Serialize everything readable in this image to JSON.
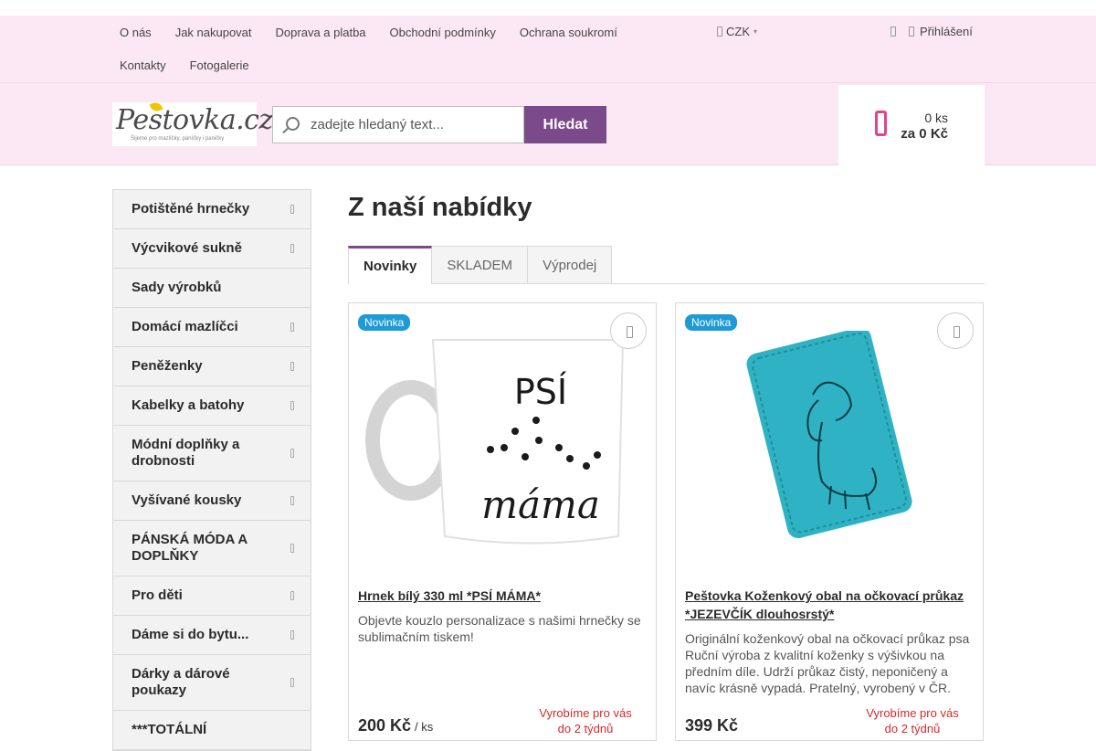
{
  "top_nav": {
    "row1": [
      "O nás",
      "Jak nakupovat",
      "Doprava a platba",
      "Obchodní podmínky",
      "Ochrana soukromí"
    ],
    "row2": [
      "Kontakty",
      "Fotogalerie"
    ],
    "currency": "CZK",
    "login": "Přihlášení"
  },
  "header": {
    "logo_text": "Pestovka.cz",
    "logo_tagline": "Šijeme pro mazlíčky, páníčky i paničky",
    "search_placeholder": "zadejte hledaný text...",
    "search_button": "Hledat",
    "cart_qty": "0 ks",
    "cart_total": "za 0 Kč"
  },
  "sidebar": {
    "items": [
      {
        "label": "Potištěné hrnečky",
        "has_sub": true
      },
      {
        "label": "Výcvikové sukně",
        "has_sub": true
      },
      {
        "label": "Sady výrobků",
        "has_sub": false
      },
      {
        "label": "Domácí mazlíčci",
        "has_sub": true
      },
      {
        "label": "Peněženky",
        "has_sub": true
      },
      {
        "label": "Kabelky a batohy",
        "has_sub": true
      },
      {
        "label": "Módní doplňky a drobnosti",
        "has_sub": true
      },
      {
        "label": "Vyšívané kousky",
        "has_sub": true
      },
      {
        "label": "PÁNSKÁ MÓDA A DOPLŇKY",
        "has_sub": true
      },
      {
        "label": "Pro děti",
        "has_sub": true
      },
      {
        "label": "Dáme si do bytu...",
        "has_sub": true
      },
      {
        "label": "Dárky a dárové poukazy",
        "has_sub": true
      },
      {
        "label": "***TOTÁLNÍ",
        "has_sub": false
      }
    ]
  },
  "main": {
    "title": "Z naší nabídky",
    "tabs": [
      {
        "label": "Novinky",
        "active": true
      },
      {
        "label": "SKLADEM",
        "active": false
      },
      {
        "label": "Výprodej",
        "active": false
      }
    ],
    "products": [
      {
        "badge": "Novinka",
        "name": "Hrnek bílý 330 ml *PSÍ MÁMA*",
        "image_text_top": "PSÍ",
        "image_text_bottom": "máma",
        "description": "Objevte kouzlo personalizace s našimi hrnečky se sublimačním tiskem!",
        "price": "200 Kč",
        "unit": "/ ks",
        "availability": "Vyrobíme pro vás do 2 týdnů"
      },
      {
        "badge": "Novinka",
        "name": "Peštovka Koženkový obal na očkovací průkaz *JEZEVČÍK dlouhosrstý*",
        "description": "Originální koženkový obal na očkovací průkaz psa Ruční výroba z kvalitní koženky s výšivkou na předním díle. Udrží průkaz čistý, neponičený a navíc krásně vypadá. Pratelný, vyrobený v ČR.",
        "price": "399 Kč",
        "availability": "Vyrobíme pro vás do 2 týdnů"
      }
    ]
  },
  "colors": {
    "accent_purple": "#7b4a8a",
    "header_pink": "#fce8f4",
    "cart_icon_pink": "#e4428e",
    "badge_blue": "#1e9ad6",
    "availability_red": "#d42a2a",
    "cover_teal": "#2fb3c4"
  },
  "icons": {
    "search": "magnifier-icon",
    "cart": "shopping-bag-icon",
    "wishlist": "heart-icon",
    "login": "user-icon",
    "chevron": "chevron-right-icon"
  }
}
